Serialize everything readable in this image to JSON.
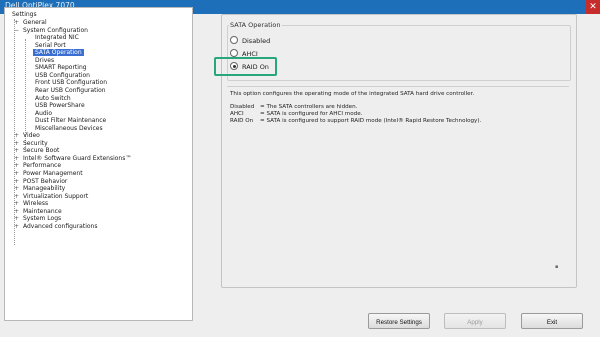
{
  "window": {
    "title": "Dell OptiPlex 7070",
    "close_glyph": "✕"
  },
  "tree": {
    "root": "Settings",
    "items": [
      {
        "label": "General",
        "level": 1,
        "expander": "+"
      },
      {
        "label": "System Configuration",
        "level": 1,
        "expander": "−"
      },
      {
        "label": "Integrated NIC",
        "level": 2
      },
      {
        "label": "Serial Port",
        "level": 2
      },
      {
        "label": "SATA Operation",
        "level": 2,
        "selected": true
      },
      {
        "label": "Drives",
        "level": 2
      },
      {
        "label": "SMART Reporting",
        "level": 2
      },
      {
        "label": "USB Configuration",
        "level": 2
      },
      {
        "label": "Front USB Configuration",
        "level": 2
      },
      {
        "label": "Rear USB Configuration",
        "level": 2
      },
      {
        "label": "Auto Switch",
        "level": 2
      },
      {
        "label": "USB PowerShare",
        "level": 2
      },
      {
        "label": "Audio",
        "level": 2
      },
      {
        "label": "Dust Filter Maintenance",
        "level": 2
      },
      {
        "label": "Miscellaneous Devices",
        "level": 2
      },
      {
        "label": "Video",
        "level": 1,
        "expander": "+"
      },
      {
        "label": "Security",
        "level": 1,
        "expander": "+"
      },
      {
        "label": "Secure Boot",
        "level": 1,
        "expander": "+"
      },
      {
        "label": "Intel® Software Guard Extensions™",
        "level": 1,
        "expander": "+"
      },
      {
        "label": "Performance",
        "level": 1,
        "expander": "+"
      },
      {
        "label": "Power Management",
        "level": 1,
        "expander": "+"
      },
      {
        "label": "POST Behavior",
        "level": 1,
        "expander": "+"
      },
      {
        "label": "Manageability",
        "level": 1,
        "expander": "+"
      },
      {
        "label": "Virtualization Support",
        "level": 1,
        "expander": "+"
      },
      {
        "label": "Wireless",
        "level": 1,
        "expander": "+"
      },
      {
        "label": "Maintenance",
        "level": 1,
        "expander": "+"
      },
      {
        "label": "System Logs",
        "level": 1,
        "expander": "+"
      },
      {
        "label": "Advanced configurations",
        "level": 1,
        "expander": "+"
      }
    ]
  },
  "sata": {
    "group_label": "SATA Operation",
    "options": [
      {
        "label": "Disabled",
        "selected": false
      },
      {
        "label": "AHCI",
        "selected": false
      },
      {
        "label": "RAID On",
        "selected": true
      }
    ]
  },
  "description": {
    "intro": "This option configures the operating mode of the integrated SATA hard drive controller.",
    "lines": [
      {
        "key": "Disabled",
        "text": "= The SATA controllers are hidden."
      },
      {
        "key": "AHCI",
        "text": "= SATA is configured for AHCI mode."
      },
      {
        "key": "RAID On",
        "text": "= SATA is configured to support RAID mode (Intel® Rapid Restore Technology)."
      }
    ]
  },
  "buttons": {
    "restore": "Restore Settings",
    "apply": "Apply",
    "exit": "Exit"
  },
  "colors": {
    "titlebar": "#1c6fb8",
    "selection": "#3a6fd1",
    "callout": "#28a87a"
  }
}
